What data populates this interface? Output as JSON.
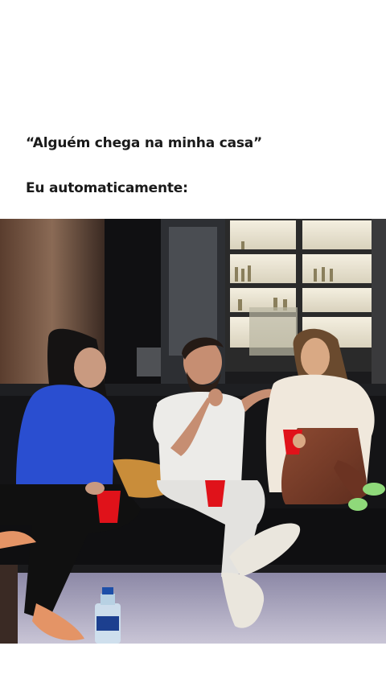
{
  "caption": {
    "line1": "“Alguém chega na minha casa”",
    "line2": "Eu automaticamente:"
  },
  "image": {
    "description_icon": "photo-three-people-on-couch"
  },
  "colors": {
    "background": "#ffffff",
    "text": "#1a1a1a"
  }
}
